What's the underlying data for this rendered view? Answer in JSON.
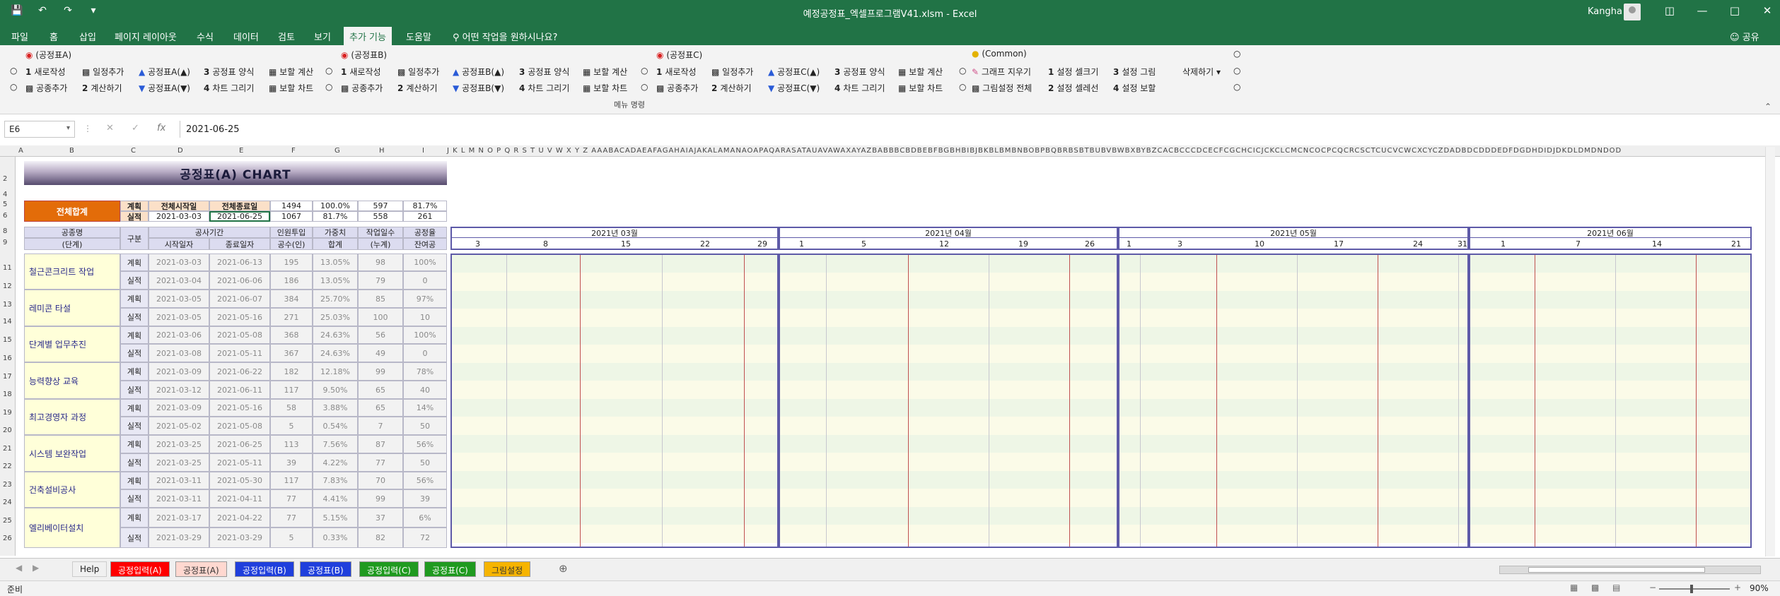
{
  "app": {
    "title": "예정공정표_엑셀프로그램V41.xlsm  -  Excel",
    "user": "Kangha",
    "qat_icons": [
      "save-icon",
      "undo-icon",
      "redo-icon",
      "customize-icon"
    ]
  },
  "menu_tabs": [
    "파일",
    "홈",
    "삽입",
    "페이지 레이아웃",
    "수식",
    "데이터",
    "검토",
    "보기",
    "추가 기능",
    "도움말"
  ],
  "active_tab": "추가 기능",
  "tell_me": "어떤 작업을 원하시나요?",
  "share": "공유",
  "ribbon": {
    "group_name": "메뉴 명령",
    "groupA": {
      "title": "(공정표A)",
      "row1": [
        "새로작성",
        "일정추가",
        "공정표A(▲)",
        "공정표 양식",
        "보할 계산"
      ],
      "row2": [
        "공종추가",
        "계산하기",
        "공정표A(▼)",
        "차트 그리기",
        "보할 차트"
      ]
    },
    "groupB": {
      "title": "(공정표B)",
      "row1": [
        "새로작성",
        "일정추가",
        "공정표B(▲)",
        "공정표 양식",
        "보할 계산"
      ],
      "row2": [
        "공종추가",
        "계산하기",
        "공정표B(▼)",
        "차트 그리기",
        "보할 차트"
      ]
    },
    "groupC": {
      "title": "(공정표C)",
      "row1": [
        "새로작성",
        "일정추가",
        "공정표C(▲)",
        "공정표 양식",
        "보할 계산"
      ],
      "row2": [
        "공종추가",
        "계산하기",
        "공정표C(▼)",
        "차트 그리기",
        "보할 차트"
      ]
    },
    "common": {
      "title": "(Common)",
      "row1": [
        "그래프 지우기",
        "설정 셀크기",
        "설정 그림"
      ],
      "row2": [
        "그림설정 전체",
        "설정 셀레선",
        "설정 보할"
      ],
      "delete": "삭제하기"
    }
  },
  "formula_bar": {
    "name_box": "E6",
    "fx": "fx",
    "value": "2021-06-25"
  },
  "sheet": {
    "banner": "공정표(A) CHART",
    "total_label": "전체합계",
    "summary": {
      "plan": [
        "계획",
        "전체시작일",
        "전체종료일",
        "1494",
        "100.0%",
        "597",
        "81.7%"
      ],
      "actual": [
        "실적",
        "2021-03-03",
        "2021-06-25",
        "1067",
        "81.7%",
        "558",
        "261"
      ]
    },
    "headers": {
      "name1": "공종명",
      "name2": "(단계)",
      "type": "구분",
      "period": "공사기간",
      "start": "시작일자",
      "end": "종료일자",
      "men1": "인원투입",
      "men2": "공수(인)",
      "wt1": "가중치",
      "wt2": "합계",
      "days1": "작업일수",
      "days2": "(누계)",
      "rate1": "공정율",
      "rate2": "잔여공"
    },
    "tasks": [
      {
        "name": "철근콘크리트 작업",
        "plan": [
          "계획",
          "2021-03-03",
          "2021-06-13",
          "195",
          "13.05%",
          "98",
          "100%"
        ],
        "actual": [
          "실적",
          "2021-03-04",
          "2021-06-06",
          "186",
          "13.05%",
          "79",
          "0"
        ]
      },
      {
        "name": "레미콘 타설",
        "plan": [
          "계획",
          "2021-03-05",
          "2021-06-07",
          "384",
          "25.70%",
          "85",
          "97%"
        ],
        "actual": [
          "실적",
          "2021-03-05",
          "2021-05-16",
          "271",
          "25.03%",
          "100",
          "10"
        ]
      },
      {
        "name": "단계별 업무추진",
        "plan": [
          "계획",
          "2021-03-06",
          "2021-05-08",
          "368",
          "24.63%",
          "56",
          "100%"
        ],
        "actual": [
          "실적",
          "2021-03-08",
          "2021-05-11",
          "367",
          "24.63%",
          "49",
          "0"
        ]
      },
      {
        "name": "능력향상 교육",
        "plan": [
          "계획",
          "2021-03-09",
          "2021-06-22",
          "182",
          "12.18%",
          "99",
          "78%"
        ],
        "actual": [
          "실적",
          "2021-03-12",
          "2021-06-11",
          "117",
          "9.50%",
          "65",
          "40"
        ]
      },
      {
        "name": "최고경영자 과정",
        "plan": [
          "계획",
          "2021-03-09",
          "2021-05-16",
          "58",
          "3.88%",
          "65",
          "14%"
        ],
        "actual": [
          "실적",
          "2021-05-02",
          "2021-05-08",
          "5",
          "0.54%",
          "7",
          "50"
        ]
      },
      {
        "name": "시스템 보완작업",
        "plan": [
          "계획",
          "2021-03-25",
          "2021-06-25",
          "113",
          "7.56%",
          "87",
          "56%"
        ],
        "actual": [
          "실적",
          "2021-03-25",
          "2021-05-11",
          "39",
          "4.22%",
          "77",
          "50"
        ]
      },
      {
        "name": "건축설비공사",
        "plan": [
          "계획",
          "2021-03-11",
          "2021-05-30",
          "117",
          "7.83%",
          "70",
          "56%"
        ],
        "actual": [
          "실적",
          "2021-03-11",
          "2021-04-11",
          "77",
          "4.41%",
          "99",
          "39"
        ]
      },
      {
        "name": "엘리베이터설치",
        "plan": [
          "계획",
          "2021-03-17",
          "2021-04-22",
          "77",
          "5.15%",
          "37",
          "6%"
        ],
        "actual": [
          "실적",
          "2021-03-29",
          "2021-03-29",
          "5",
          "0.33%",
          "82",
          "72"
        ]
      }
    ],
    "months": [
      "2021년 03월",
      "2021년 04월",
      "2021년 05월",
      "2021년 06월"
    ],
    "days": [
      "3",
      "8",
      "15",
      "22",
      "29",
      "1",
      "5",
      "12",
      "19",
      "26",
      "1",
      "3",
      "10",
      "17",
      "24",
      "31",
      "1",
      "7",
      "14",
      "21"
    ]
  },
  "sheet_tabs": [
    {
      "label": "Help",
      "color": "#f0f0f0",
      "text": "#333333"
    },
    {
      "label": "공정입력(A)",
      "color": "#ff0000",
      "text": "#ffffff"
    },
    {
      "label": "공정표(A)",
      "color": "#ffd8d0",
      "text": "#333333"
    },
    {
      "label": "공정입력(B)",
      "color": "#1f3fdc",
      "text": "#ffffff"
    },
    {
      "label": "공정표(B)",
      "color": "#1f3fdc",
      "text": "#ffffff"
    },
    {
      "label": "공정입력(C)",
      "color": "#1f9a1f",
      "text": "#ffffff"
    },
    {
      "label": "공정표(C)",
      "color": "#1f9a1f",
      "text": "#ffffff"
    },
    {
      "label": "그림설정",
      "color": "#f6b400",
      "text": "#333333"
    }
  ],
  "status": {
    "ready": "준비",
    "zoom": "90%"
  }
}
